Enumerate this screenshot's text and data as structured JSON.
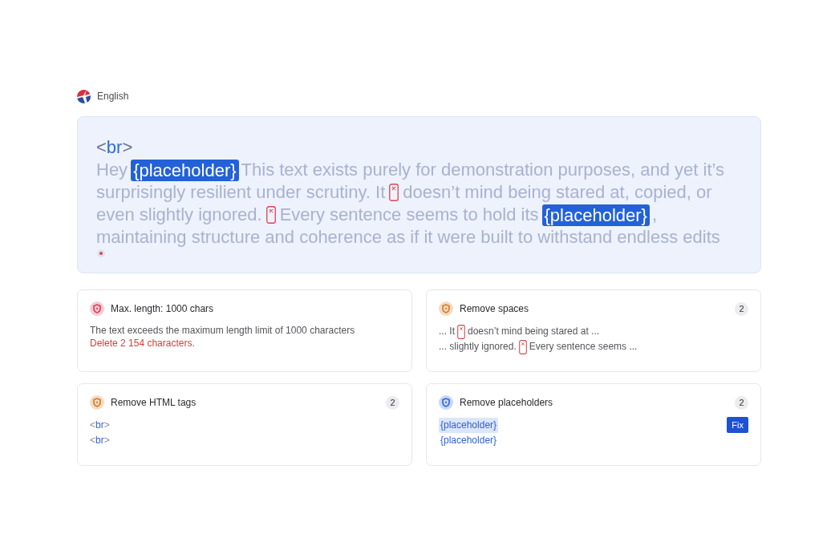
{
  "language": {
    "label": "English"
  },
  "editor": {
    "tag": {
      "open": "<",
      "name": "br",
      "close": ">"
    },
    "lines": [
      [
        {
          "kind": "text",
          "text": "Hey"
        },
        {
          "kind": "placeholder",
          "text": "{placeholder}"
        },
        {
          "kind": "text",
          "text": "This text exists purely for demonstration purposes, and yet it’s"
        }
      ],
      [
        {
          "kind": "text",
          "text": "surprisingly resilient under scrutiny. It"
        },
        {
          "kind": "space"
        },
        {
          "kind": "text",
          "text": "doesn’t mind being stared at, copied, or"
        }
      ],
      [
        {
          "kind": "text",
          "text": "even slightly ignored."
        },
        {
          "kind": "space"
        },
        {
          "kind": "text",
          "text": "Every sentence seems to hold its"
        },
        {
          "kind": "placeholder",
          "text": "{placeholder}"
        },
        {
          "kind": "text",
          "text": ","
        }
      ],
      [
        {
          "kind": "text",
          "text": "maintaining structure and coherence as if it were built to withstand endless edits"
        }
      ]
    ]
  },
  "issues": [
    {
      "kind": "length",
      "color": "#e0455f",
      "title": "Max. length: 1000 chars",
      "message": "The text exceeds the maximum length limit of 1000 characters",
      "action": "Delete 2 154 characters."
    },
    {
      "kind": "spaces",
      "color": "#d9822b",
      "title": "Remove spaces",
      "count": "2",
      "snippets": [
        {
          "before": "... It",
          "after": "doesn’t mind being stared at ..."
        },
        {
          "before": "... slightly ignored.",
          "after": "Every sentence seems ..."
        }
      ]
    },
    {
      "kind": "tags",
      "color": "#d9822b",
      "title": "Remove HTML tags",
      "count": "2",
      "tags": [
        {
          "open": "<",
          "name": "br",
          "close": ">"
        },
        {
          "open": "<",
          "name": "br",
          "close": ">"
        }
      ]
    },
    {
      "kind": "placeholders",
      "color": "#3b6fd8",
      "title": "Remove placeholders",
      "count": "2",
      "items": [
        {
          "text": "{placeholder}",
          "selected": true
        },
        {
          "text": "{placeholder}",
          "selected": false
        }
      ],
      "button": "Fix"
    }
  ]
}
